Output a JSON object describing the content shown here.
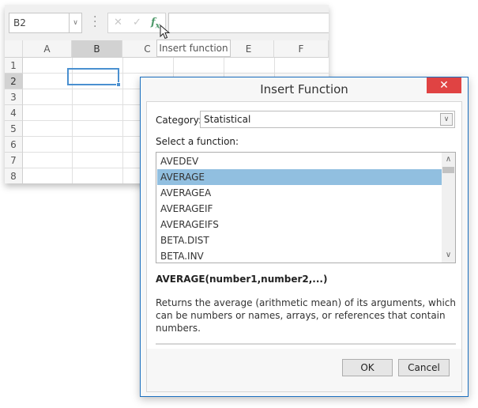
{
  "spreadsheet": {
    "name_box": "B2",
    "formula_bar": {
      "cancel_icon": "✕",
      "enter_icon": "✓",
      "insert_function_icon": "fx",
      "value": ""
    },
    "columns": [
      "A",
      "B",
      "C",
      "D",
      "E",
      "F"
    ],
    "rows": [
      "1",
      "2",
      "3",
      "4",
      "5",
      "6",
      "7",
      "8"
    ],
    "selected_column": "B",
    "selected_row": "2",
    "tooltip": "Insert function"
  },
  "dialog": {
    "title": "Insert Function",
    "close_icon": "✕",
    "category_label": "Category:",
    "category_value": "Statistical",
    "select_label": "Select a function:",
    "functions": [
      "AVEDEV",
      "AVERAGE",
      "AVERAGEA",
      "AVERAGEIF",
      "AVERAGEIFS",
      "BETA.DIST",
      "BETA.INV"
    ],
    "selected_function": "AVERAGE",
    "syntax": "AVERAGE(number1,number2,...)",
    "description": "Returns the average (arithmetic mean) of its arguments, which can be numbers or names, arrays, or references that contain numbers.",
    "ok_label": "OK",
    "cancel_label": "Cancel"
  }
}
